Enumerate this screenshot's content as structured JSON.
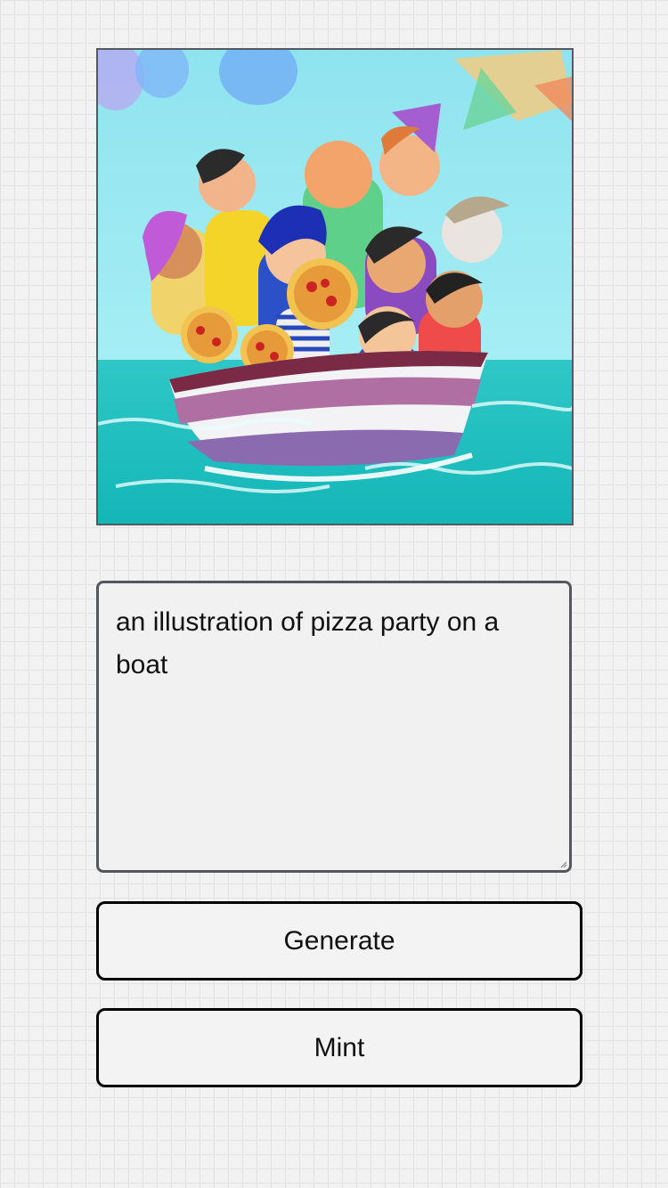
{
  "generated_image": {
    "icon": "pizza-party-boat-illustration"
  },
  "prompt": {
    "value": "an illustration of pizza party on a boat"
  },
  "buttons": {
    "generate_label": "Generate",
    "mint_label": "Mint"
  },
  "colors": {
    "background": "#f2f2f2",
    "border": "#55575c",
    "button_border": "#000000"
  }
}
